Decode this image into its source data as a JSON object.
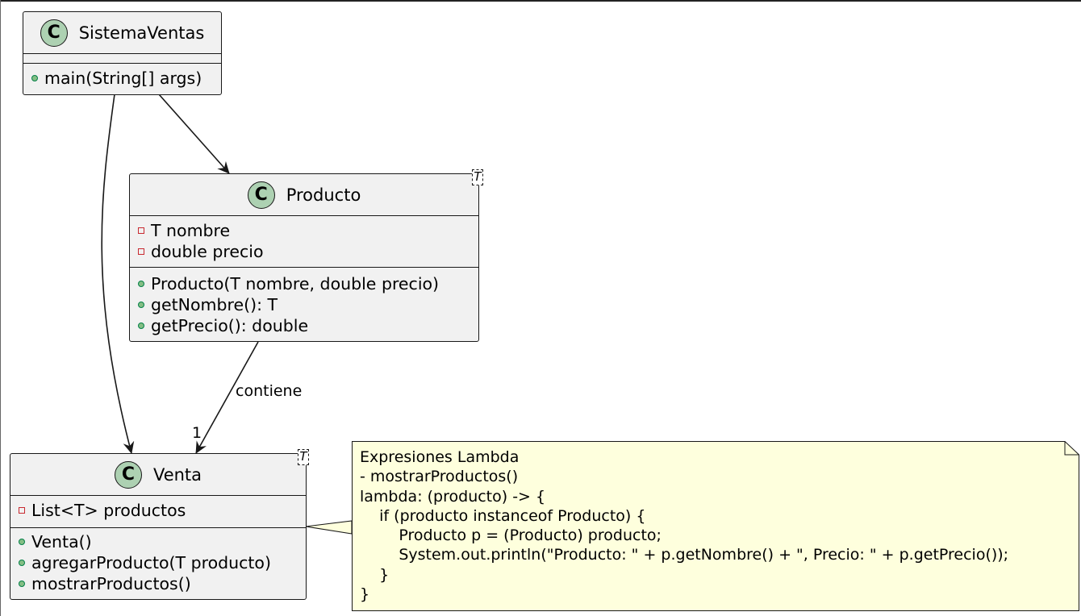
{
  "classes": {
    "sistema_ventas": {
      "name": "SistemaVentas",
      "icon": "C",
      "fields": [],
      "methods": [
        {
          "visibility": "public",
          "text": "main(String[] args)"
        }
      ]
    },
    "producto": {
      "name": "Producto",
      "icon": "C",
      "type_param": "T",
      "fields": [
        {
          "visibility": "private",
          "text": "T nombre"
        },
        {
          "visibility": "private",
          "text": "double precio"
        }
      ],
      "methods": [
        {
          "visibility": "public",
          "text": "Producto(T nombre, double precio)"
        },
        {
          "visibility": "public",
          "text": "getNombre(): T"
        },
        {
          "visibility": "public",
          "text": "getPrecio(): double"
        }
      ]
    },
    "venta": {
      "name": "Venta",
      "icon": "C",
      "type_param": "T",
      "fields": [
        {
          "visibility": "private",
          "text": "List<T> productos"
        }
      ],
      "methods": [
        {
          "visibility": "public",
          "text": "Venta()"
        },
        {
          "visibility": "public",
          "text": "agregarProducto(T producto)"
        },
        {
          "visibility": "public",
          "text": "mostrarProductos()"
        }
      ]
    }
  },
  "edges": {
    "producto_venta_label": "contiene",
    "producto_venta_multiplicity": "1"
  },
  "note": {
    "lines": [
      "Expresiones Lambda",
      "- mostrarProductos()",
      "lambda: (producto) -> {",
      "    if (producto instanceof Producto) {",
      "        Producto p = (Producto) producto;",
      "        System.out.println(\"Producto: \" + p.getNombre() + \", Precio: \" + p.getPrecio());",
      "    }",
      "}"
    ]
  },
  "colors": {
    "class_fill": "#f1f1f1",
    "class_border": "#181818",
    "badge_fill": "#add1b2",
    "public_dot": "#84be84",
    "private_square": "#c82930",
    "note_fill": "#feffdd"
  }
}
